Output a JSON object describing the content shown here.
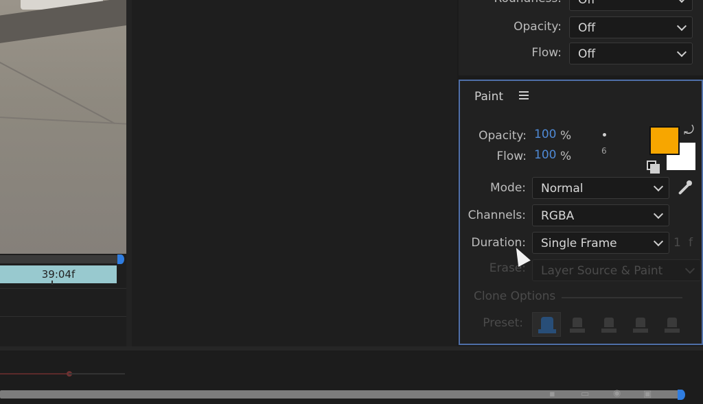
{
  "timeline": {
    "current_time": "39:04f"
  },
  "brush_dynamics": {
    "roundness": {
      "label": "Roundness:",
      "value": "Off"
    },
    "opacity": {
      "label": "Opacity:",
      "value": "Off"
    },
    "flow": {
      "label": "Flow:",
      "value": "Off"
    }
  },
  "paint": {
    "title": "Paint",
    "opacity_label": "Opacity:",
    "opacity_value": "100",
    "opacity_unit": "%",
    "flow_label": "Flow:",
    "flow_value": "100",
    "flow_unit": "%",
    "brush_size": "6",
    "foreground_color": "#F7A600",
    "background_color": "#FFFFFF",
    "mode_label": "Mode:",
    "mode_value": "Normal",
    "channels_label": "Channels:",
    "channels_value": "RGBA",
    "duration_label": "Duration:",
    "duration_value": "Single Frame",
    "duration_frames": "1",
    "duration_unit": "f",
    "erase_label": "Erase:",
    "erase_value": "Layer Source & Paint",
    "clone_options_label": "Clone Options",
    "preset_label": "Preset:"
  },
  "colors": {
    "accent": "#2F7DE1",
    "panel_border": "#4F6FA8",
    "value_blue": "#4F8AD6"
  }
}
